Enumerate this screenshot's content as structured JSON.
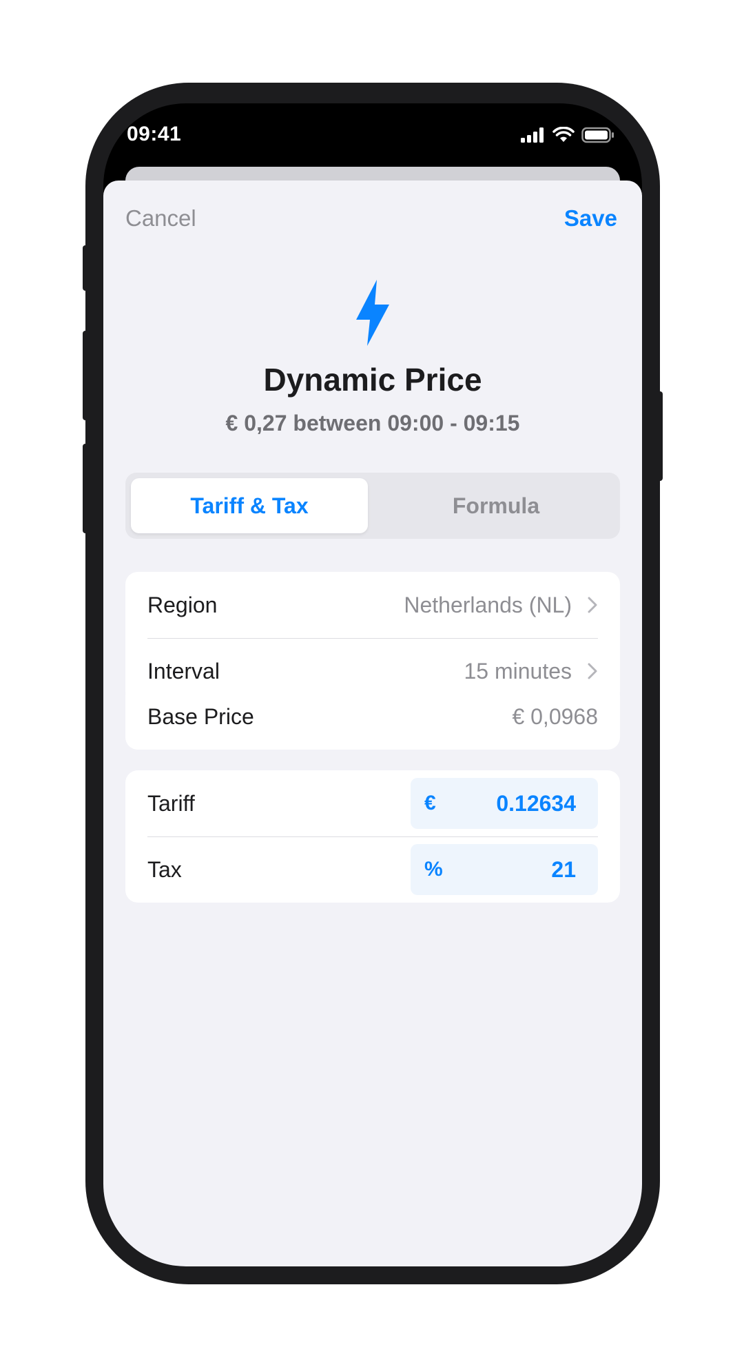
{
  "status_bar": {
    "time": "09:41"
  },
  "nav": {
    "cancel_label": "Cancel",
    "save_label": "Save"
  },
  "header": {
    "icon": "bolt-icon",
    "title": "Dynamic Price",
    "subtitle": "€ 0,27 between 09:00 - 09:15"
  },
  "tabs": [
    {
      "label": "Tariff & Tax",
      "selected": true
    },
    {
      "label": "Formula",
      "selected": false
    }
  ],
  "settings": {
    "region": {
      "label": "Region",
      "value": "Netherlands (NL)"
    },
    "interval": {
      "label": "Interval",
      "value": "15 minutes"
    }
  },
  "base_price": {
    "label": "Base Price",
    "value": "€ 0,0968"
  },
  "tariff": {
    "label": "Tariff",
    "prefix": "€",
    "value": "0.12634"
  },
  "tax": {
    "label": "Tax",
    "prefix": "%",
    "value": "21"
  },
  "colors": {
    "accent": "#0a84ff",
    "sheet_background": "#f2f2f7",
    "field_background": "#eef5fd",
    "secondary_text": "#8e8e93"
  }
}
